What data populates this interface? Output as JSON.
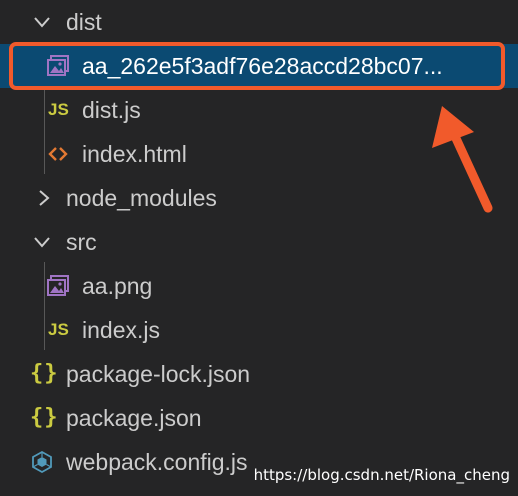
{
  "explorer": {
    "items": [
      {
        "label": "dist",
        "kind": "folder",
        "expanded": true
      },
      {
        "label": "aa_262e5f3adf76e28accd28bc07...",
        "kind": "image-file",
        "selected": true
      },
      {
        "label": "dist.js",
        "kind": "js-file"
      },
      {
        "label": "index.html",
        "kind": "html-file"
      },
      {
        "label": "node_modules",
        "kind": "folder",
        "expanded": false
      },
      {
        "label": "src",
        "kind": "folder",
        "expanded": true
      },
      {
        "label": "aa.png",
        "kind": "image-file"
      },
      {
        "label": "index.js",
        "kind": "js-file"
      },
      {
        "label": "package-lock.json",
        "kind": "json-file"
      },
      {
        "label": "package.json",
        "kind": "json-file"
      },
      {
        "label": "webpack.config.js",
        "kind": "webpack-file"
      }
    ],
    "js_badge": "JS",
    "json_badge": "{}",
    "html_badge": "<>"
  },
  "annotation": {
    "box_color": "#f15a2b",
    "arrow_color": "#f15a2b"
  },
  "watermark": "https://blog.csdn.net/Riona_cheng",
  "colors": {
    "background": "#252526",
    "selection": "#0b4a72",
    "text": "#cccccc",
    "js_yellow": "#cbcb41",
    "html_orange": "#e37933",
    "image_purple": "#a074c4",
    "webpack_blue": "#519aba"
  }
}
